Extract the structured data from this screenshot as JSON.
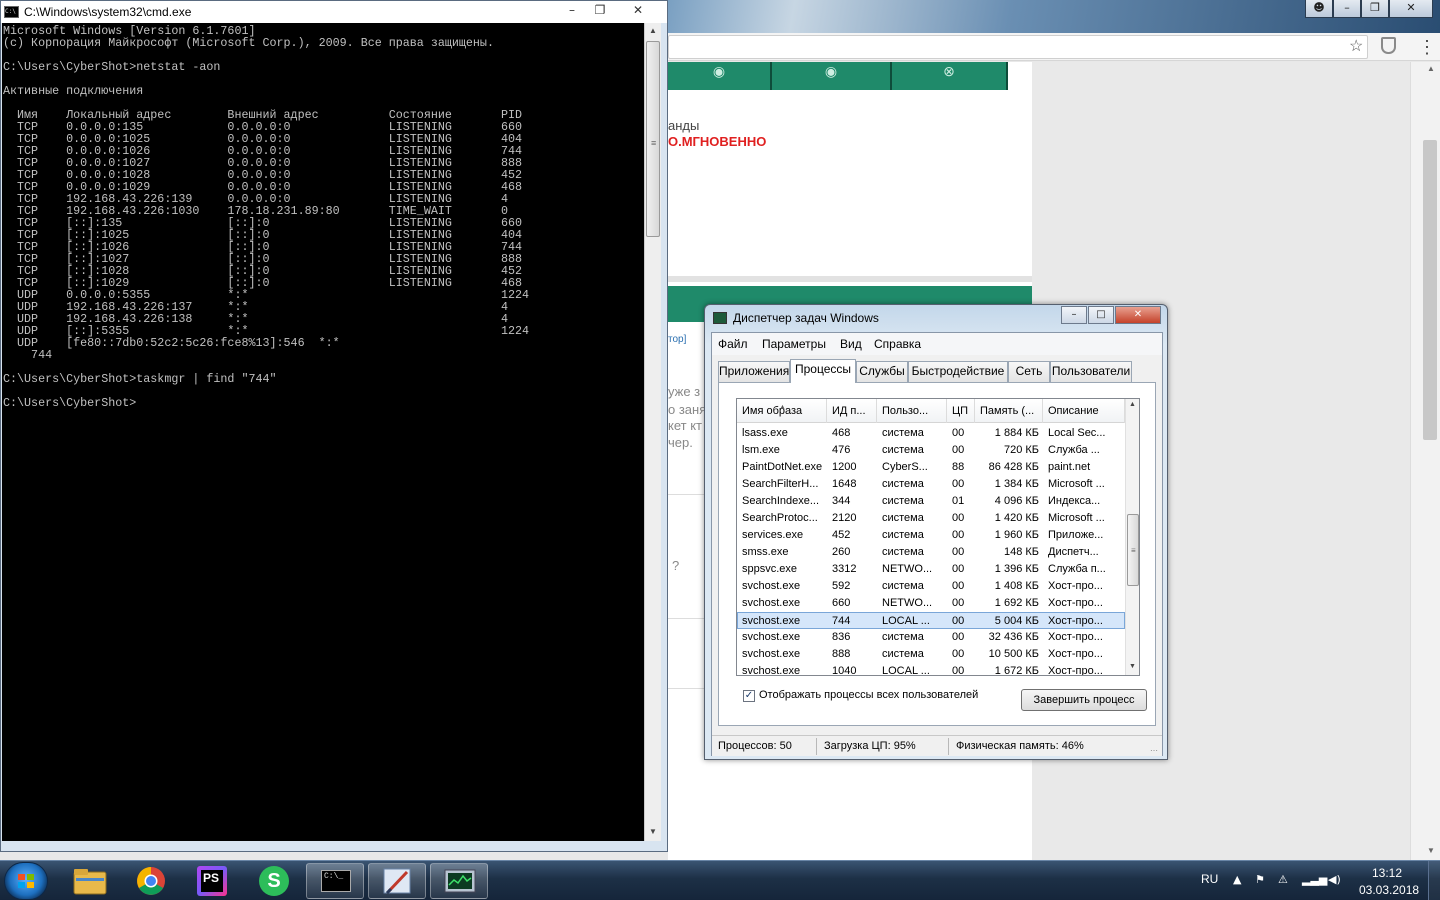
{
  "cmd": {
    "title": "C:\\Windows\\system32\\cmd.exe",
    "icon_text": "C:\\",
    "output": "Microsoft Windows [Version 6.1.7601]\n(c) Корпорация Майкрософт (Microsoft Corp.), 2009. Все права защищены.\n\nC:\\Users\\CyberShot>netstat -aon\n\nАктивные подключения\n\n  Имя    Локальный адрес        Внешний адрес          Состояние       PID\n  TCP    0.0.0.0:135            0.0.0.0:0              LISTENING       660\n  TCP    0.0.0.0:1025           0.0.0.0:0              LISTENING       404\n  TCP    0.0.0.0:1026           0.0.0.0:0              LISTENING       744\n  TCP    0.0.0.0:1027           0.0.0.0:0              LISTENING       888\n  TCP    0.0.0.0:1028           0.0.0.0:0              LISTENING       452\n  TCP    0.0.0.0:1029           0.0.0.0:0              LISTENING       468\n  TCP    192.168.43.226:139     0.0.0.0:0              LISTENING       4\n  TCP    192.168.43.226:1030    178.18.231.89:80       TIME_WAIT       0\n  TCP    [::]:135               [::]:0                 LISTENING       660\n  TCP    [::]:1025              [::]:0                 LISTENING       404\n  TCP    [::]:1026              [::]:0                 LISTENING       744\n  TCP    [::]:1027              [::]:0                 LISTENING       888\n  TCP    [::]:1028              [::]:0                 LISTENING       452\n  TCP    [::]:1029              [::]:0                 LISTENING       468\n  UDP    0.0.0.0:5355           *:*                                    1224\n  UDP    192.168.43.226:137     *:*                                    4\n  UDP    192.168.43.226:138     *:*                                    4\n  UDP    [::]:5355              *:*                                    1224\n  UDP    [fe80::7db0:52c2:5c26:fce8%13]:546  *:*\n    744\n\nC:\\Users\\CyberShot>taskmgr | find \"744\"\n\nC:\\Users\\CyberShot>"
  },
  "browser": {
    "site_text_1": "анды",
    "site_text_2": "О.МГНОВЕННО",
    "site_small_link": "тор]",
    "site_grey_lines": [
      "ужe з",
      "о заня",
      "кет кт",
      "чер."
    ],
    "site_question": "?"
  },
  "taskmgr": {
    "title": "Диспетчер задач Windows",
    "menu": [
      "Файл",
      "Параметры",
      "Вид",
      "Справка"
    ],
    "tabs": [
      "Приложения",
      "Процессы",
      "Службы",
      "Быстродействие",
      "Сеть",
      "Пользователи"
    ],
    "active_tab": "Процессы",
    "columns": [
      "Имя образа",
      "ИД п...",
      "Пользо...",
      "ЦП",
      "Память (...",
      "Описание"
    ],
    "rows": [
      {
        "name": "lsass.exe",
        "pid": "468",
        "user": "система",
        "cpu": "00",
        "mem": "1 884 КБ",
        "desc": "Local Sec..."
      },
      {
        "name": "lsm.exe",
        "pid": "476",
        "user": "система",
        "cpu": "00",
        "mem": "720 КБ",
        "desc": "Служба ..."
      },
      {
        "name": "PaintDotNet.exe",
        "pid": "1200",
        "user": "CyberS...",
        "cpu": "88",
        "mem": "86 428 КБ",
        "desc": "paint.net"
      },
      {
        "name": "SearchFilterH...",
        "pid": "1648",
        "user": "система",
        "cpu": "00",
        "mem": "1 384 КБ",
        "desc": "Microsoft ..."
      },
      {
        "name": "SearchIndexe...",
        "pid": "344",
        "user": "система",
        "cpu": "01",
        "mem": "4 096 КБ",
        "desc": "Индекса..."
      },
      {
        "name": "SearchProtoc...",
        "pid": "2120",
        "user": "система",
        "cpu": "00",
        "mem": "1 420 КБ",
        "desc": "Microsoft ..."
      },
      {
        "name": "services.exe",
        "pid": "452",
        "user": "система",
        "cpu": "00",
        "mem": "1 960 КБ",
        "desc": "Приложе..."
      },
      {
        "name": "smss.exe",
        "pid": "260",
        "user": "система",
        "cpu": "00",
        "mem": "148 КБ",
        "desc": "Диспетч..."
      },
      {
        "name": "sppsvc.exe",
        "pid": "3312",
        "user": "NETWO...",
        "cpu": "00",
        "mem": "1 396 КБ",
        "desc": "Служба п..."
      },
      {
        "name": "svchost.exe",
        "pid": "592",
        "user": "система",
        "cpu": "00",
        "mem": "1 408 КБ",
        "desc": "Хост-про..."
      },
      {
        "name": "svchost.exe",
        "pid": "660",
        "user": "NETWO...",
        "cpu": "00",
        "mem": "1 692 КБ",
        "desc": "Хост-про..."
      },
      {
        "name": "svchost.exe",
        "pid": "744",
        "user": "LOCAL ...",
        "cpu": "00",
        "mem": "5 004 КБ",
        "desc": "Хост-про...",
        "selected": true
      },
      {
        "name": "svchost.exe",
        "pid": "836",
        "user": "система",
        "cpu": "00",
        "mem": "32 436 КБ",
        "desc": "Хост-про..."
      },
      {
        "name": "svchost.exe",
        "pid": "888",
        "user": "система",
        "cpu": "00",
        "mem": "10 500 КБ",
        "desc": "Хост-про..."
      },
      {
        "name": "svchost.exe",
        "pid": "1040",
        "user": "LOCAL ...",
        "cpu": "00",
        "mem": "1 672 КБ",
        "desc": "Хост-про..."
      }
    ],
    "show_all_label": "Отображать процессы всех пользователей",
    "show_all_checked": true,
    "end_process_label": "Завершить процесс",
    "status": {
      "processes": "Процессов: 50",
      "cpu": "Загрузка ЦП: 95%",
      "memory": "Физическая память: 46%"
    }
  },
  "taskbar": {
    "apps": [
      "explorer-icon",
      "chrome-icon",
      "phpstorm-icon",
      "skype-icon",
      "cmd-icon",
      "paint-net-icon",
      "task-manager-icon"
    ],
    "phpstorm_text": "PS",
    "skype_text": "S",
    "cmd_text": "C:\\_",
    "language": "RU",
    "time": "13:12",
    "date": "03.03.2018"
  }
}
